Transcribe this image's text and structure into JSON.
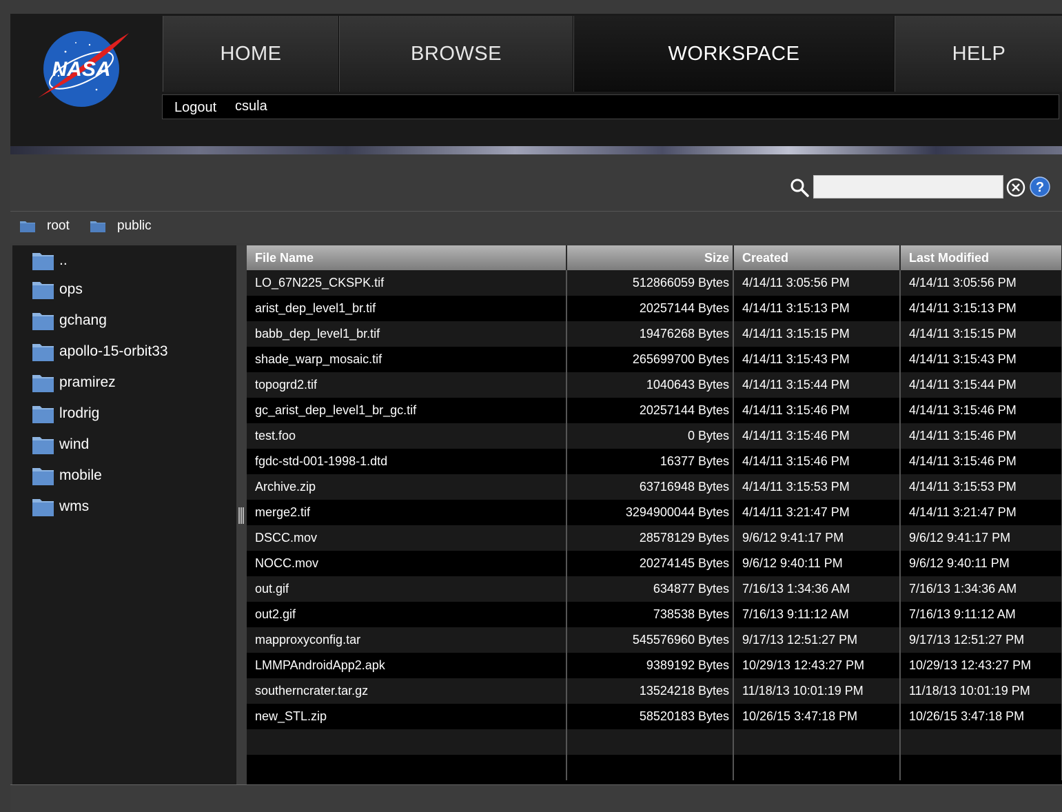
{
  "logo": {
    "text": "NASA",
    "brand_blue": "#1f5fbf",
    "brand_red": "#e0201f"
  },
  "nav": [
    {
      "label": "HOME",
      "active": false
    },
    {
      "label": "BROWSE",
      "active": false
    },
    {
      "label": "WORKSPACE",
      "active": true
    },
    {
      "label": "HELP",
      "active": false
    }
  ],
  "user": {
    "logout_label": "Logout",
    "username": "csula"
  },
  "search": {
    "value": "",
    "placeholder": ""
  },
  "breadcrumb": [
    {
      "label": "root"
    },
    {
      "label": "public"
    }
  ],
  "sidebar": {
    "items": [
      {
        "label": ".."
      },
      {
        "label": "ops"
      },
      {
        "label": "gchang"
      },
      {
        "label": "apollo-15-orbit33"
      },
      {
        "label": "pramirez"
      },
      {
        "label": "lrodrig"
      },
      {
        "label": "wind"
      },
      {
        "label": "mobile"
      },
      {
        "label": "wms"
      }
    ]
  },
  "table": {
    "headers": {
      "name": "File Name",
      "size": "Size",
      "created": "Created",
      "modified": "Last Modified"
    },
    "rows": [
      {
        "name": "LO_67N225_CKSPK.tif",
        "size": "512866059 Bytes",
        "created": "4/14/11 3:05:56 PM",
        "modified": "4/14/11 3:05:56 PM"
      },
      {
        "name": "arist_dep_level1_br.tif",
        "size": "20257144 Bytes",
        "created": "4/14/11 3:15:13 PM",
        "modified": "4/14/11 3:15:13 PM"
      },
      {
        "name": "babb_dep_level1_br.tif",
        "size": "19476268 Bytes",
        "created": "4/14/11 3:15:15 PM",
        "modified": "4/14/11 3:15:15 PM"
      },
      {
        "name": "shade_warp_mosaic.tif",
        "size": "265699700 Bytes",
        "created": "4/14/11 3:15:43 PM",
        "modified": "4/14/11 3:15:43 PM"
      },
      {
        "name": "topogrd2.tif",
        "size": "1040643 Bytes",
        "created": "4/14/11 3:15:44 PM",
        "modified": "4/14/11 3:15:44 PM"
      },
      {
        "name": "gc_arist_dep_level1_br_gc.tif",
        "size": "20257144 Bytes",
        "created": "4/14/11 3:15:46 PM",
        "modified": "4/14/11 3:15:46 PM"
      },
      {
        "name": "test.foo",
        "size": "0 Bytes",
        "created": "4/14/11 3:15:46 PM",
        "modified": "4/14/11 3:15:46 PM"
      },
      {
        "name": "fgdc-std-001-1998-1.dtd",
        "size": "16377 Bytes",
        "created": "4/14/11 3:15:46 PM",
        "modified": "4/14/11 3:15:46 PM"
      },
      {
        "name": "Archive.zip",
        "size": "63716948 Bytes",
        "created": "4/14/11 3:15:53 PM",
        "modified": "4/14/11 3:15:53 PM"
      },
      {
        "name": "merge2.tif",
        "size": "3294900044 Bytes",
        "created": "4/14/11 3:21:47 PM",
        "modified": "4/14/11 3:21:47 PM"
      },
      {
        "name": "DSCC.mov",
        "size": "28578129 Bytes",
        "created": "9/6/12 9:41:17 PM",
        "modified": "9/6/12 9:41:17 PM"
      },
      {
        "name": "NOCC.mov",
        "size": "20274145 Bytes",
        "created": "9/6/12 9:40:11 PM",
        "modified": "9/6/12 9:40:11 PM"
      },
      {
        "name": "out.gif",
        "size": "634877 Bytes",
        "created": "7/16/13 1:34:36 AM",
        "modified": "7/16/13 1:34:36 AM"
      },
      {
        "name": "out2.gif",
        "size": "738538 Bytes",
        "created": "7/16/13 9:11:12 AM",
        "modified": "7/16/13 9:11:12 AM"
      },
      {
        "name": "mapproxyconfig.tar",
        "size": "545576960 Bytes",
        "created": "9/17/13 12:51:27 PM",
        "modified": "9/17/13 12:51:27 PM"
      },
      {
        "name": "LMMPAndroidApp2.apk",
        "size": "9389192 Bytes",
        "created": "10/29/13 12:43:27 PM",
        "modified": "10/29/13 12:43:27 PM"
      },
      {
        "name": "southerncrater.tar.gz",
        "size": "13524218 Bytes",
        "created": "11/18/13 10:01:19 PM",
        "modified": "11/18/13 10:01:19 PM"
      },
      {
        "name": "new_STL.zip",
        "size": "58520183 Bytes",
        "created": "10/26/15 3:47:18 PM",
        "modified": "10/26/15 3:47:18 PM"
      },
      {
        "name": "",
        "size": "",
        "created": "",
        "modified": ""
      },
      {
        "name": "",
        "size": "",
        "created": "",
        "modified": ""
      }
    ]
  },
  "colors": {
    "folder": "#6f9ed4",
    "help": "#2f6fd0",
    "table_header": "#9a9a9a"
  }
}
